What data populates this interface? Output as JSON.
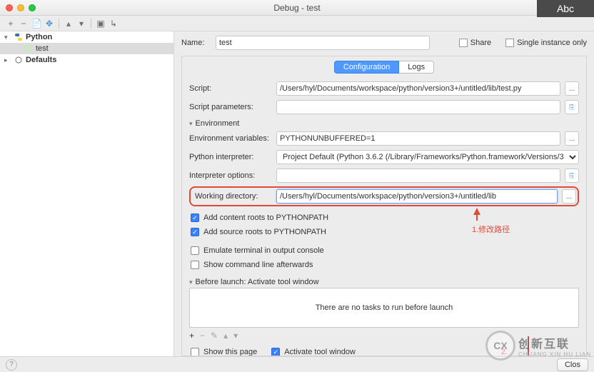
{
  "window": {
    "title": "Debug - test"
  },
  "badge": "Abc",
  "sidebar": {
    "items": [
      {
        "label": "Python"
      },
      {
        "label": "test"
      },
      {
        "label": "Defaults"
      }
    ]
  },
  "name_row": {
    "label": "Name:",
    "value": "test",
    "share": "Share",
    "single": "Single instance only"
  },
  "tabs": {
    "config": "Configuration",
    "logs": "Logs"
  },
  "form": {
    "script_label": "Script:",
    "script_value": "/Users/hyl/Documents/workspace/python/version3+/untitled/lib/test.py",
    "script_params_label": "Script parameters:",
    "env_section": "Environment",
    "env_vars_label": "Environment variables:",
    "env_vars_value": "PYTHONUNBUFFERED=1",
    "interpreter_label": "Python interpreter:",
    "interpreter_value": "Project Default (Python 3.6.2 (/Library/Frameworks/Python.framework/Versions/3",
    "interp_opts_label": "Interpreter options:",
    "workdir_label": "Working directory:",
    "workdir_value": "/Users/hyl/Documents/workspace/python/version3+/untitled/lib",
    "add_content": "Add content roots to PYTHONPATH",
    "add_source": "Add source roots to PYTHONPATH",
    "emulate": "Emulate terminal in output console",
    "show_cmd": "Show command line afterwards"
  },
  "annotations": {
    "a1": "1.修改路径",
    "a2": "2."
  },
  "before_launch": {
    "title": "Before launch: Activate tool window",
    "empty": "There are no tasks to run before launch",
    "show_page": "Show this page",
    "activate": "Activate tool window"
  },
  "footer": {
    "close": "Clos"
  },
  "watermark": {
    "cn": "创新互联",
    "en": "CHUANG XIN HU LIAN"
  }
}
